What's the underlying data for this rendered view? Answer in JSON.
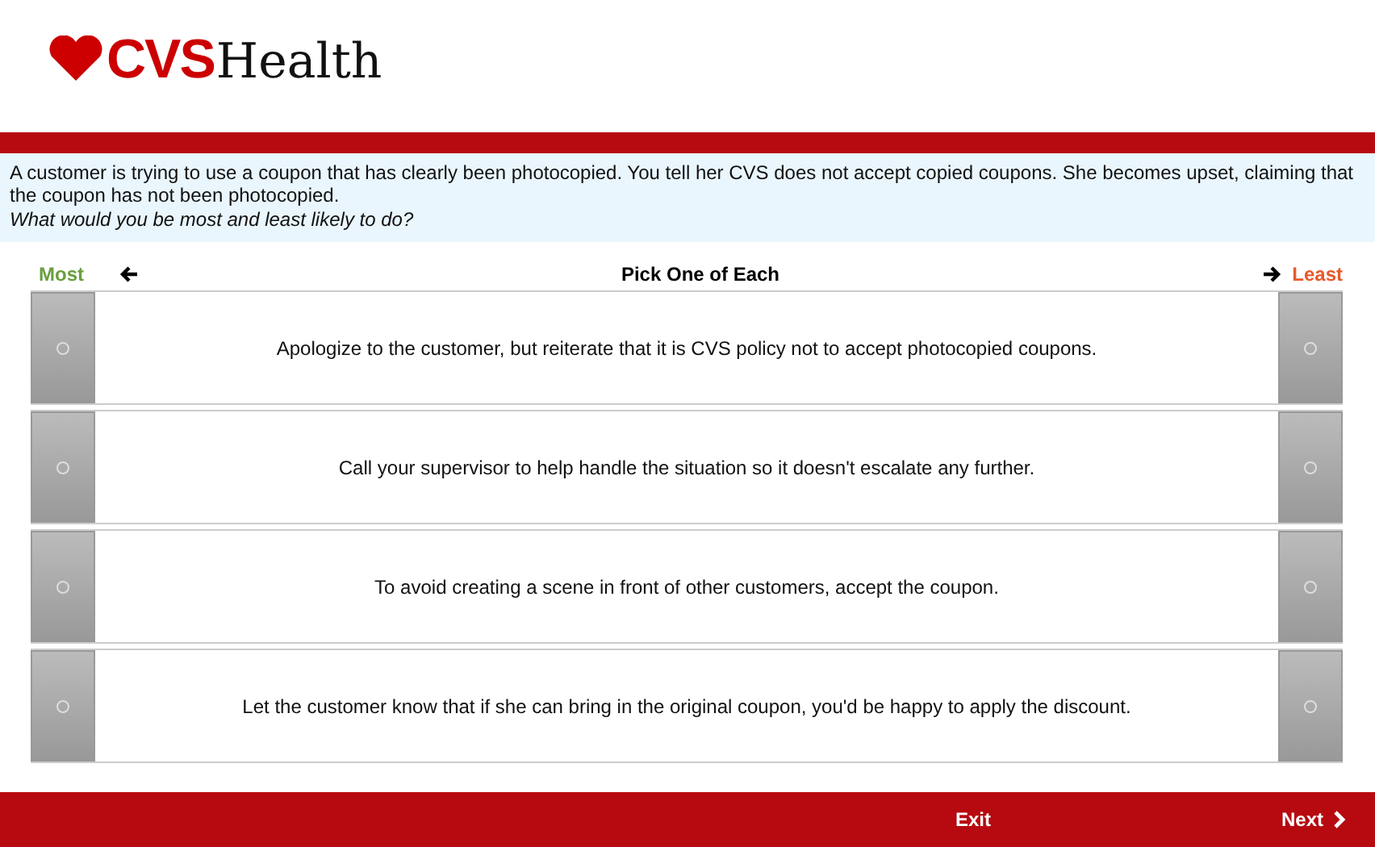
{
  "logo": {
    "brand": "CVS",
    "suffix": "Health"
  },
  "prompt": {
    "text": "A customer is trying to use a coupon that has clearly been photocopied. You tell her CVS does not accept copied coupons. She becomes upset, claiming that the coupon has not been photocopied.",
    "question": "What would you be most and least likely to do?"
  },
  "header": {
    "most": "Most",
    "title": "Pick One of Each",
    "least": "Least"
  },
  "options": [
    {
      "text": "Apologize to the customer, but reiterate that it is CVS policy not to accept photocopied coupons.",
      "most_selected": false,
      "least_selected": false
    },
    {
      "text": "Call your supervisor to help handle the situation so it doesn't escalate any further.",
      "most_selected": false,
      "least_selected": false
    },
    {
      "text": "To avoid creating a scene in front of other customers, accept the coupon.",
      "most_selected": false,
      "least_selected": false
    },
    {
      "text": "Let the customer know that if she can bring in the original coupon, you'd be happy to apply the discount.",
      "most_selected": false,
      "least_selected": false
    }
  ],
  "footer": {
    "exit": "Exit",
    "next": "Next"
  }
}
